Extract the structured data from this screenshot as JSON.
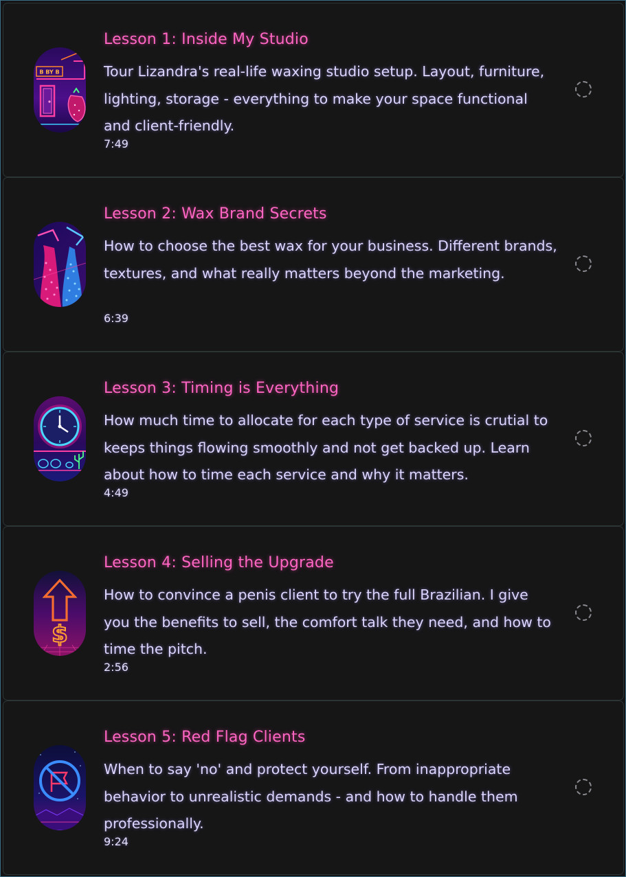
{
  "lessons": [
    {
      "title": "Lesson 1: Inside My Studio",
      "description": "Tour Lizandra's real-life waxing studio setup. Layout, furniture, lighting, storage - everything to make your space functional and client-friendly.",
      "duration": "7:49",
      "status": "not-started",
      "thumbnail_icon": "storefront-icon",
      "thumbnail_text": "B BY B"
    },
    {
      "title": "Lesson 2: Wax Brand Secrets",
      "description": "How to choose the best wax for your business. Different brands, textures, and what really matters beyond the marketing.",
      "duration": "6:39",
      "status": "not-started",
      "thumbnail_icon": "wax-pour-icon"
    },
    {
      "title": "Lesson 3: Timing is Everything",
      "description": "How much time to allocate for each type of service is crutial to keeps things flowing smoothly and not get backed up. Learn about how to time each service and why it matters.",
      "duration": "4:49",
      "status": "not-started",
      "thumbnail_icon": "clock-icon"
    },
    {
      "title": "Lesson 4: Selling the Upgrade",
      "description": "How to convince a penis client to try the full Brazilian. I give you the benefits to sell, the comfort talk they need, and how to time the pitch.",
      "duration": "2:56",
      "status": "not-started",
      "thumbnail_icon": "dollar-up-arrow-icon"
    },
    {
      "title": "Lesson 5: Red Flag Clients",
      "description": "When to say 'no' and protect yourself. From inappropriate behavior to unrealistic demands - and how to handle them professionally.",
      "duration": "9:24",
      "status": "not-started",
      "thumbnail_icon": "no-flag-icon"
    }
  ],
  "colors": {
    "title": "#ff66c4",
    "text": "#dcd6ff",
    "card_bg": "#161617",
    "card_border": "#2b3534",
    "status_ring": "#8a8a90"
  }
}
